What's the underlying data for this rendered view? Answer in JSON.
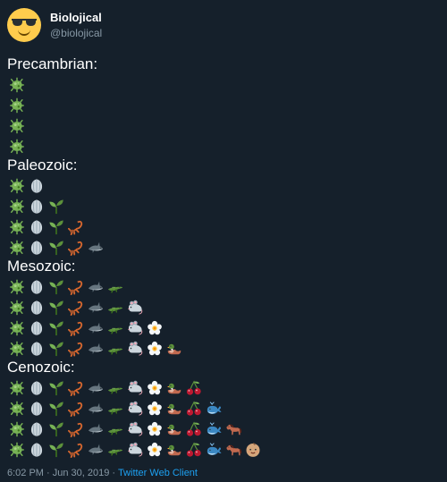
{
  "author": {
    "display_name": "Biolojical",
    "handle": "@biolojical",
    "avatar_icon": "smiling-face-with-sunglasses-icon"
  },
  "eras": [
    {
      "title": "Precambrian:",
      "rows": [
        [
          "microbe"
        ],
        [
          "microbe"
        ],
        [
          "microbe"
        ],
        [
          "microbe"
        ]
      ]
    },
    {
      "title": "Paleozoic:",
      "rows": [
        [
          "microbe",
          "shell"
        ],
        [
          "microbe",
          "shell",
          "seedling"
        ],
        [
          "microbe",
          "shell",
          "seedling",
          "scorpion"
        ],
        [
          "microbe",
          "shell",
          "seedling",
          "scorpion",
          "shark"
        ]
      ]
    },
    {
      "title": "Mesozoic:",
      "rows": [
        [
          "microbe",
          "shell",
          "seedling",
          "scorpion",
          "shark",
          "crocodile"
        ],
        [
          "microbe",
          "shell",
          "seedling",
          "scorpion",
          "shark",
          "crocodile",
          "mouse"
        ],
        [
          "microbe",
          "shell",
          "seedling",
          "scorpion",
          "shark",
          "crocodile",
          "mouse",
          "blossom"
        ],
        [
          "microbe",
          "shell",
          "seedling",
          "scorpion",
          "shark",
          "crocodile",
          "mouse",
          "blossom",
          "duck"
        ]
      ]
    },
    {
      "title": "Cenozoic:",
      "rows": [
        [
          "microbe",
          "shell",
          "seedling",
          "scorpion",
          "shark",
          "crocodile",
          "mouse",
          "blossom",
          "duck",
          "cherries"
        ],
        [
          "microbe",
          "shell",
          "seedling",
          "scorpion",
          "shark",
          "crocodile",
          "mouse",
          "blossom",
          "duck",
          "cherries",
          "whale"
        ],
        [
          "microbe",
          "shell",
          "seedling",
          "scorpion",
          "shark",
          "crocodile",
          "mouse",
          "blossom",
          "duck",
          "cherries",
          "whale",
          "horse"
        ],
        [
          "microbe",
          "shell",
          "seedling",
          "scorpion",
          "shark",
          "crocodile",
          "mouse",
          "blossom",
          "duck",
          "cherries",
          "whale",
          "horse",
          "baby"
        ]
      ]
    }
  ],
  "footer": {
    "timestamp": "6:02 PM · Jun 30, 2019 · ",
    "source": "Twitter Web Client"
  }
}
